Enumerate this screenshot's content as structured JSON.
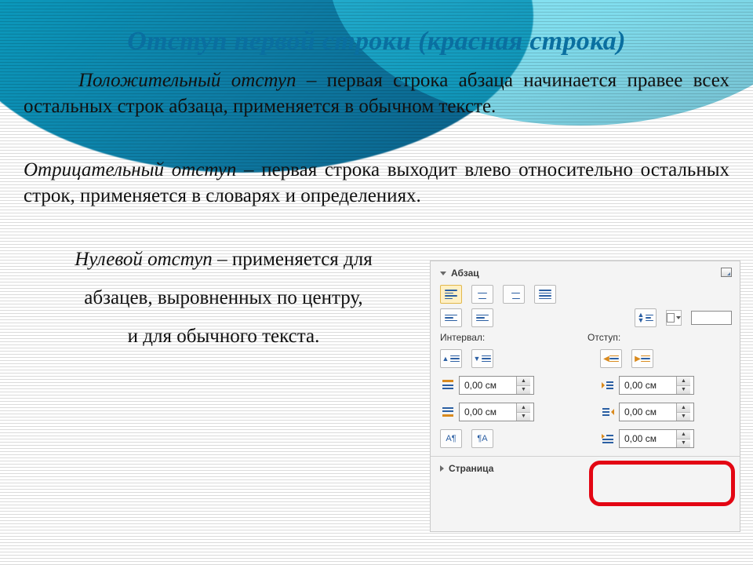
{
  "title": "Отступ первой строки (красная строка)",
  "paragraphs": {
    "positive_term": "Положительный отступ",
    "positive_rest": " – первая строка абзаца начинается правее всех остальных строк абзаца, применяется в обычном тексте.",
    "negative_term": "Отрицательный отступ",
    "negative_rest": " – первая строка выходит влево относительно остальных строк, применяется в словарях и определениях.",
    "zero_term": "Нулевой отступ",
    "zero_rest": " – применяется для",
    "zero_line2": "абзацев, выровненных по центру,",
    "zero_line3": "и для обычного текста."
  },
  "panel": {
    "section_paragraph": "Абзац",
    "section_page": "Страница",
    "label_interval": "Интервал:",
    "label_indent": "Отступ:",
    "values": {
      "space_before": "0,00 см",
      "space_after": "0,00 см",
      "indent_before": "0,00 см",
      "indent_after": "0,00 см",
      "first_line": "0,00 см"
    }
  }
}
